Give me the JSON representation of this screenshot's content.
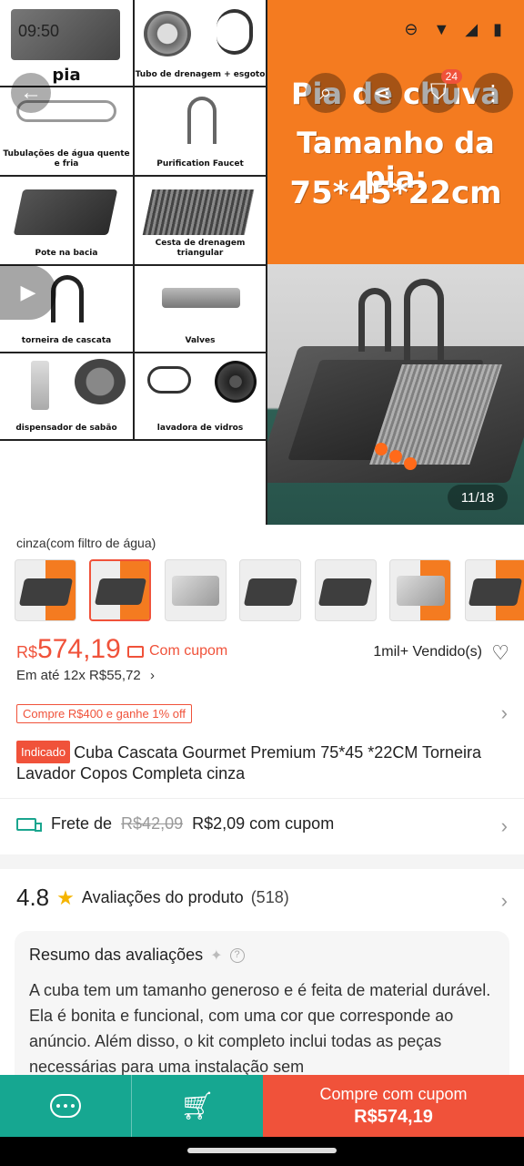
{
  "status_bar": {
    "time": "09:50"
  },
  "hero": {
    "grid_captions": {
      "sink": "pia",
      "drain": "Tubo de drenagem + esgoto",
      "pipes": "Tubulações de água quente e fria",
      "faucet": "Purification Faucet",
      "bowl": "Pote na bacia",
      "basket": "Cesta de drenagem triangular",
      "waterfall": "torneira de cascata",
      "valves": "Valves",
      "soap": "dispensador de sabão",
      "glass_washer": "lavadora de vidros"
    },
    "banner": {
      "line1": "Pia de chuva",
      "line2": "Tamanho da pia:",
      "line3": "75*45*22cm"
    },
    "cart_count": "24",
    "image_counter": "11/18"
  },
  "variant": {
    "label": "cinza(com filtro de água)"
  },
  "price": {
    "currency": "R$",
    "amount": "574,19",
    "coupon_label": "Com cupom",
    "sold": "1mil+ Vendido(s)",
    "installments": "Em até 12x R$55,72"
  },
  "promo": {
    "label": "Compre R$400 e ganhe 1% off"
  },
  "product": {
    "badge": "Indicado",
    "title": "Cuba Cascata Gourmet Premium 75*45 *22CM Torneira Lavador Copos Completa cinza"
  },
  "shipping": {
    "prefix": "Frete de",
    "old_price": "R$42,09",
    "new_price": "R$2,09 com cupom"
  },
  "reviews": {
    "score": "4.8",
    "label": "Avaliações do produto",
    "count": "(518)",
    "summary_title": "Resumo das avaliações",
    "summary_text": "A cuba tem um tamanho generoso e é feita de material durável. Ela é bonita e funcional, com uma cor que corresponde ao anúncio. Além disso, o kit completo inclui todas as peças necessárias para uma instalação sem"
  },
  "bottom_bar": {
    "buy_label": "Compre com cupom",
    "buy_price": "R$574,19"
  },
  "colors": {
    "accent": "#f0523a",
    "teal": "#16a791",
    "banner_orange": "#f47b20"
  }
}
